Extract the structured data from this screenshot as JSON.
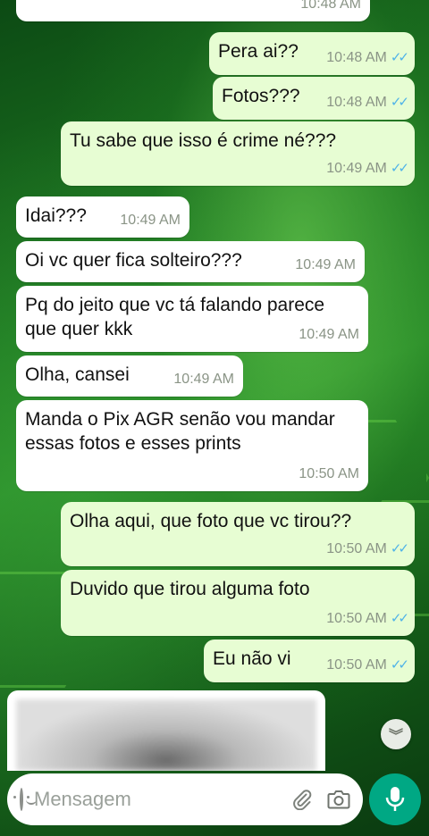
{
  "messages": [
    {
      "dir": "in",
      "text": "",
      "time": "10:48 AM",
      "ticks": false
    },
    {
      "dir": "out",
      "text": "Pera ai??",
      "time": "10:48 AM",
      "ticks": true
    },
    {
      "dir": "out",
      "text": "Fotos???",
      "time": "10:48 AM",
      "ticks": true
    },
    {
      "dir": "out",
      "text": "Tu sabe que isso é crime né???",
      "time": "10:49 AM",
      "ticks": true
    },
    {
      "dir": "in",
      "text": "Idai???",
      "time": "10:49 AM",
      "ticks": false
    },
    {
      "dir": "in",
      "text": "Oi vc quer fica solteiro???",
      "time": "10:49 AM",
      "ticks": false
    },
    {
      "dir": "in",
      "text": "Pq do jeito que vc tá falando parece que quer kkk",
      "time": "10:49 AM",
      "ticks": false
    },
    {
      "dir": "in",
      "text": "Olha, cansei",
      "time": "10:49 AM",
      "ticks": false
    },
    {
      "dir": "in",
      "text": "Manda o Pix AGR senão vou mandar essas fotos e esses prints",
      "time": "10:50 AM",
      "ticks": false
    },
    {
      "dir": "out",
      "text": "Olha aqui, que foto que vc tirou??",
      "time": "10:50 AM",
      "ticks": true
    },
    {
      "dir": "out",
      "text": "Duvido que tirou alguma foto",
      "time": "10:50 AM",
      "ticks": true
    },
    {
      "dir": "out",
      "text": "Eu não vi",
      "time": "10:50 AM",
      "ticks": true
    }
  ],
  "ticks_glyph": "✓✓",
  "composer": {
    "placeholder": "Mensagem",
    "emoji_icon": "emoji-icon",
    "attach_icon": "paperclip-icon",
    "camera_icon": "camera-icon",
    "mic_icon": "microphone-icon"
  },
  "scroll_down_glyph": "︾",
  "colors": {
    "incoming_bubble": "#ffffff",
    "outgoing_bubble": "#e7fdd3",
    "read_ticks": "#4fb3e8",
    "mic_button": "#00a884"
  }
}
